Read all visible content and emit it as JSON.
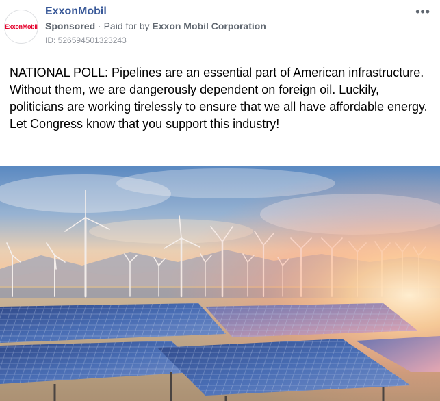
{
  "ad": {
    "logo_text": "ExxonMobil",
    "advertiser": "ExxonMobil",
    "sponsored_label": "Sponsored",
    "separator": "·",
    "paid_for_prefix": "Paid for by",
    "paid_for_by": "Exxon Mobil Corporation",
    "ad_id": "ID: 526594501323243",
    "more_icon": "more-options-icon",
    "more_glyph": "•••",
    "body_text": "NATIONAL POLL: Pipelines are an essential part of American infrastructure. Without them, we are dangerously dependent on foreign oil. Luckily, politicians are working tirelessly to ensure that we all have affordable energy. Let Congress know that you support this industry!",
    "image_subject": "wind turbines and solar panels at sunset"
  },
  "colors": {
    "advertiser_link": "#385898",
    "logo_red": "#e4002b",
    "meta_gray": "#606770",
    "panel_blue": "#2a4f9e"
  }
}
